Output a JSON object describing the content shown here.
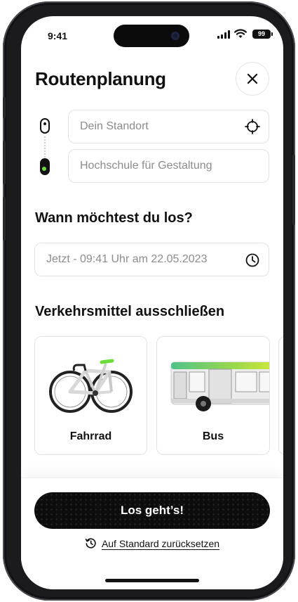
{
  "status_bar": {
    "time": "9:41",
    "battery": "99"
  },
  "header": {
    "title": "Routenplanung"
  },
  "route": {
    "start_placeholder": "Dein Standort",
    "destination_value": "Hochschule für Gestaltung"
  },
  "departure": {
    "heading": "Wann möchtest du los?",
    "value": "Jetzt - 09:41 Uhr am 22.05.2023"
  },
  "transport": {
    "heading": "Verkehrsmittel ausschließen",
    "options": [
      {
        "label": "Fahrrad",
        "icon": "bicycle-image"
      },
      {
        "label": "Bus",
        "icon": "bus-image"
      },
      {
        "label": "",
        "icon": ""
      }
    ]
  },
  "actions": {
    "submit_label": "Los geht’s!",
    "reset_label": "Auf Standard zurücksetzen"
  },
  "colors": {
    "accent_green": "#6bdc3a",
    "text": "#111111",
    "placeholder": "#8c8c8c",
    "button": "#0d0d0d"
  }
}
